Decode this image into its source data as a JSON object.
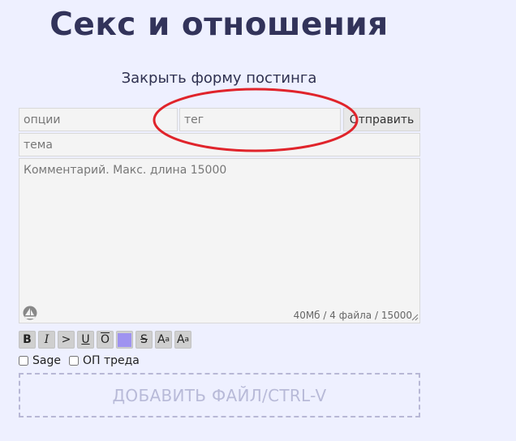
{
  "board": {
    "title": "Секс и отношения"
  },
  "form": {
    "close_label": "Закрыть форму постинга",
    "options_placeholder": "опции",
    "tag_placeholder": "тег",
    "submit_label": "Отправить",
    "subject_placeholder": "тема",
    "comment_placeholder": "Комментарий. Макс. длина 15000",
    "limits_text": "40Мб / 4 файла / 15000",
    "sage_label": "Sage",
    "op_label": "ОП треда",
    "dropzone_label": "ДОБАВИТЬ ФАЙЛ/CTRL-V"
  },
  "markup": {
    "bold": "B",
    "italic": "I",
    "quote": ">",
    "underline": "U",
    "overline": "O",
    "strike": "S",
    "sup_main": "A",
    "sup_small": "a",
    "sub_main": "A",
    "sub_small": "a"
  },
  "annotation": {
    "ellipse_color": "#e0242b"
  },
  "colors": {
    "background": "#eef0ff",
    "title": "#32335a",
    "spoiler": "#9f93f0"
  }
}
